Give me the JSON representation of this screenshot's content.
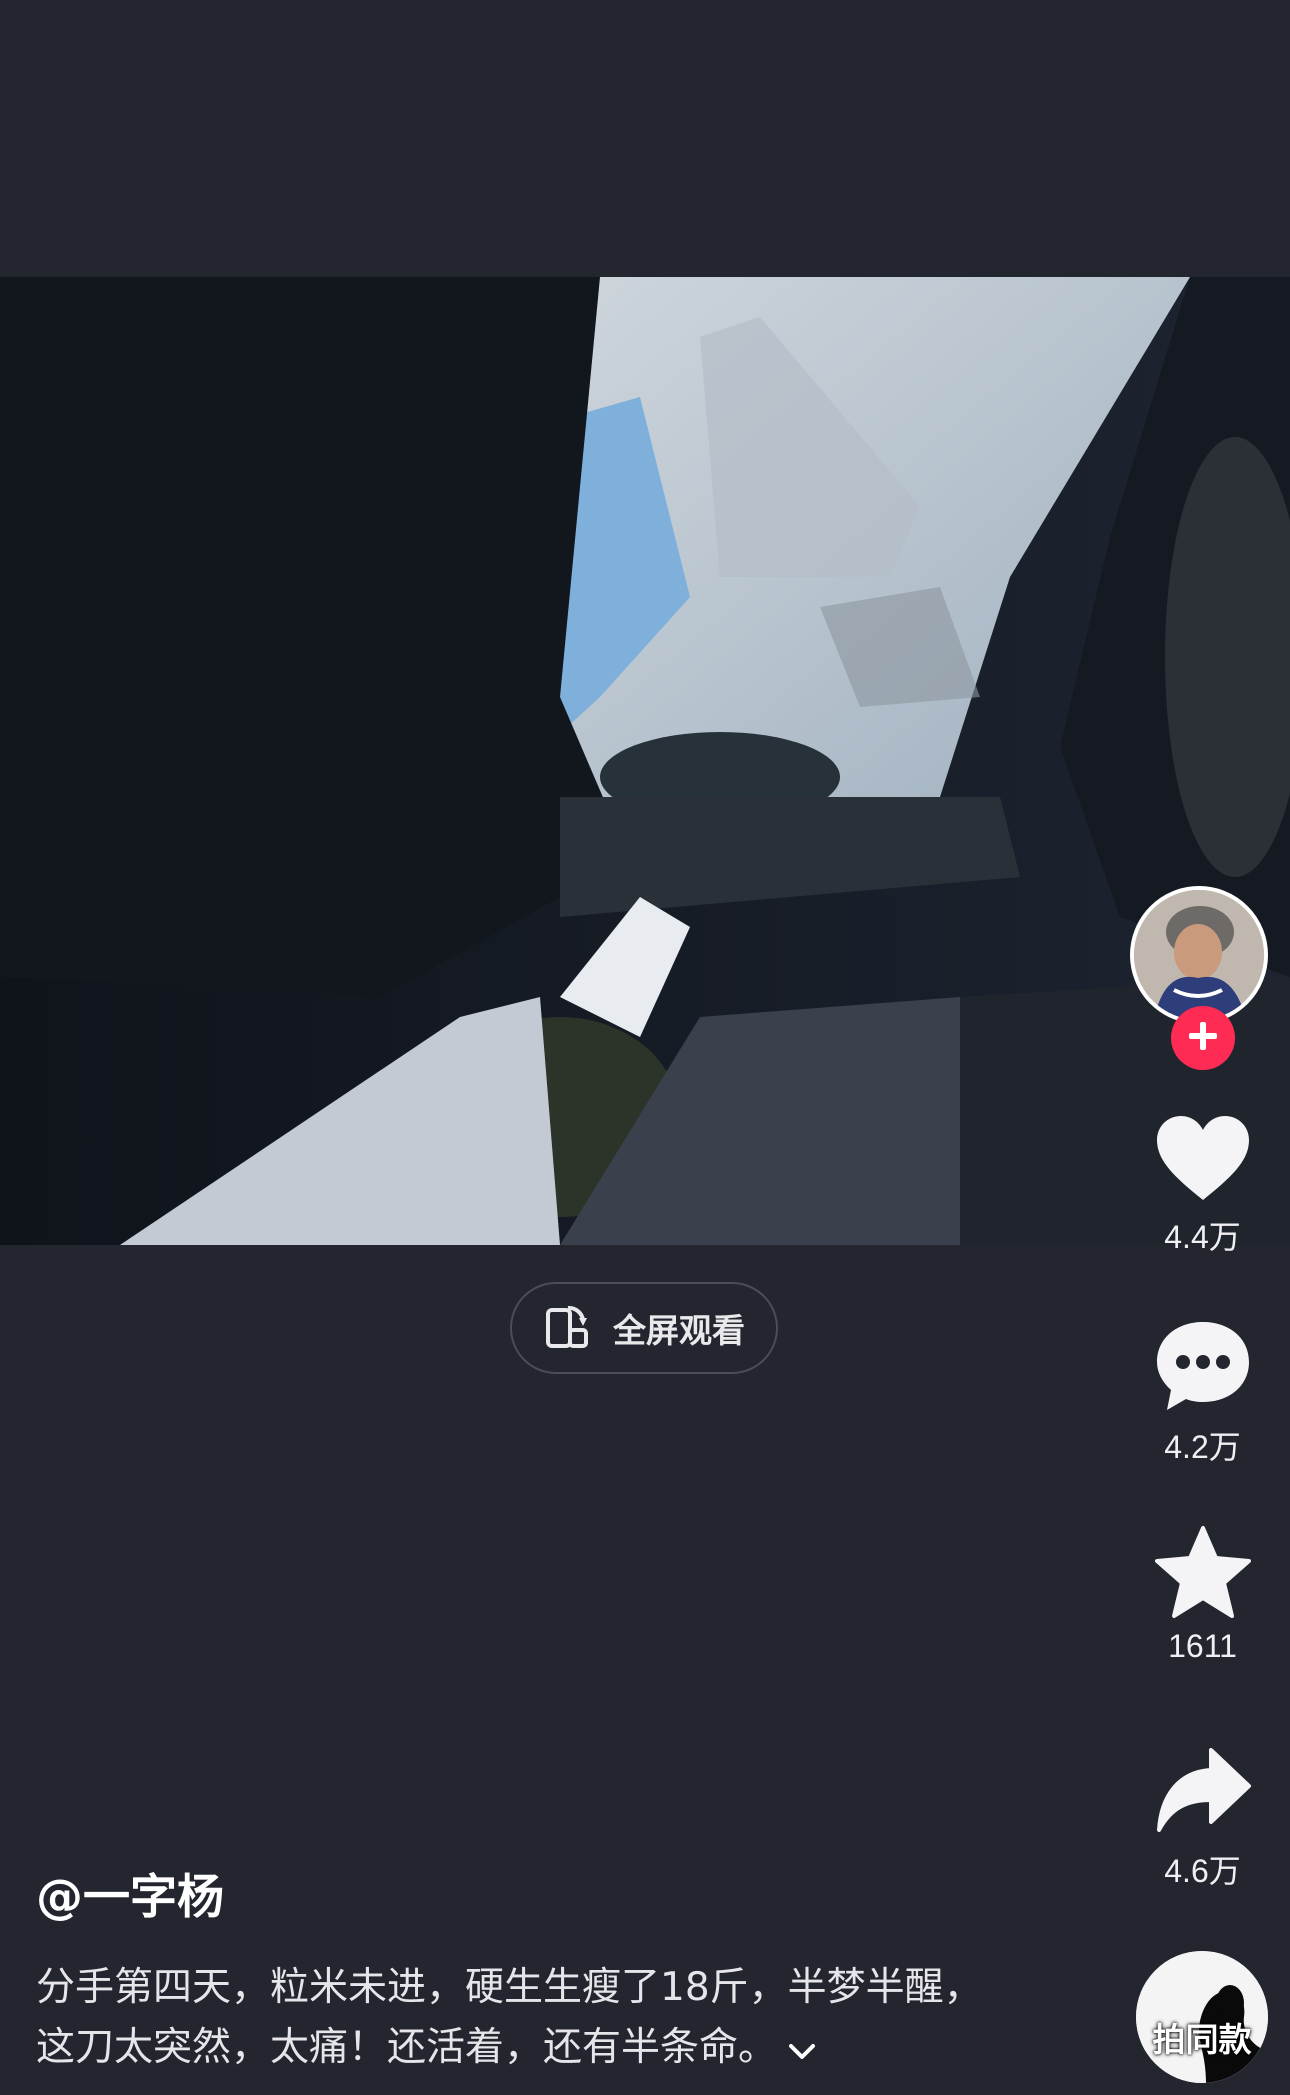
{
  "video": {
    "fullscreen_label": "全屏观看"
  },
  "author": {
    "handle": "@一字杨"
  },
  "caption": {
    "text": "分手第四天，粒米未进，硬生生瘦了18斤，半梦半醒，这刀太突然，太痛！还活着，还有半条命。"
  },
  "actions": {
    "likes": "4.4万",
    "comments": "4.2万",
    "favorites": "1611",
    "shares": "4.6万"
  },
  "music": {
    "label": "拍同款"
  },
  "colors": {
    "background": "#23252f",
    "follow_accent": "#fe2c55"
  }
}
